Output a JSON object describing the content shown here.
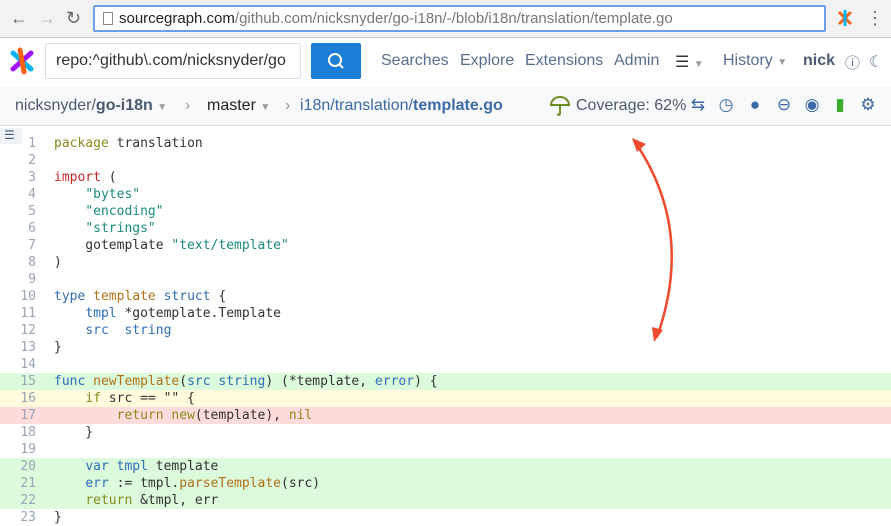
{
  "browser": {
    "url_host": "sourcegraph.com",
    "url_path": "/github.com/nicksnyder/go-i18n/-/blob/i18n/translation/template.go",
    "back_icon": "←",
    "forward_icon": "→",
    "reload_icon": "↻",
    "menu_icon": "⋮"
  },
  "nav": {
    "search_value": "repo:^github\\.com/nicksnyder/go",
    "links": [
      "Searches",
      "Explore",
      "Extensions",
      "Admin"
    ],
    "history": "History",
    "user": "nick"
  },
  "crumbs": {
    "repo_owner": "nicksnyder/",
    "repo_name": "go-i18n",
    "branch": "master",
    "path_dir1": "i18n",
    "sep": "/",
    "path_dir2": "translation",
    "file": "template.go",
    "coverage": "Coverage: 62%"
  },
  "colors": {
    "accent": "#1c7ed6",
    "covered": "#dcfadc",
    "partial": "#fffbdc",
    "uncovered": "#ffdcdc",
    "annotation_arrow": "#f04a2e"
  },
  "code": [
    {
      "n": "1",
      "c": "",
      "t": [
        [
          "package",
          "kw"
        ],
        [
          " translation",
          "id"
        ]
      ]
    },
    {
      "n": "2",
      "c": "",
      "t": []
    },
    {
      "n": "3",
      "c": "",
      "t": [
        [
          "import",
          "imp"
        ],
        [
          " (",
          "id"
        ]
      ]
    },
    {
      "n": "4",
      "c": "",
      "t": [
        [
          "    ",
          "id"
        ],
        [
          "\"bytes\"",
          "str"
        ]
      ]
    },
    {
      "n": "5",
      "c": "",
      "t": [
        [
          "    ",
          "id"
        ],
        [
          "\"encoding\"",
          "str"
        ]
      ]
    },
    {
      "n": "6",
      "c": "",
      "t": [
        [
          "    ",
          "id"
        ],
        [
          "\"strings\"",
          "str"
        ]
      ]
    },
    {
      "n": "7",
      "c": "",
      "t": [
        [
          "    gotemplate ",
          "id"
        ],
        [
          "\"text/template\"",
          "str"
        ]
      ]
    },
    {
      "n": "8",
      "c": "",
      "t": [
        [
          ")",
          "id"
        ]
      ]
    },
    {
      "n": "9",
      "c": "",
      "t": []
    },
    {
      "n": "10",
      "c": "",
      "t": [
        [
          "type",
          "typ"
        ],
        [
          " ",
          "id"
        ],
        [
          "template",
          "fn"
        ],
        [
          " ",
          "id"
        ],
        [
          "struct",
          "typ"
        ],
        [
          " {",
          "id"
        ]
      ]
    },
    {
      "n": "11",
      "c": "",
      "t": [
        [
          "    ",
          "id"
        ],
        [
          "tmpl",
          "typ"
        ],
        [
          " *gotemplate.Template",
          "id"
        ]
      ]
    },
    {
      "n": "12",
      "c": "",
      "t": [
        [
          "    ",
          "id"
        ],
        [
          "src",
          "typ"
        ],
        [
          "  ",
          "id"
        ],
        [
          "string",
          "typ"
        ]
      ]
    },
    {
      "n": "13",
      "c": "",
      "t": [
        [
          "}",
          "id"
        ]
      ]
    },
    {
      "n": "14",
      "c": "",
      "t": []
    },
    {
      "n": "15",
      "c": "g",
      "t": [
        [
          "func",
          "typ"
        ],
        [
          " ",
          "id"
        ],
        [
          "newTemplate",
          "fn"
        ],
        [
          "(",
          "id"
        ],
        [
          "src",
          "typ"
        ],
        [
          " ",
          "id"
        ],
        [
          "string",
          "typ"
        ],
        [
          ") (*template, ",
          "id"
        ],
        [
          "error",
          "typ"
        ],
        [
          ") {",
          "id"
        ]
      ]
    },
    {
      "n": "16",
      "c": "y",
      "t": [
        [
          "    ",
          "id"
        ],
        [
          "if",
          "kw"
        ],
        [
          " src == \"\" {",
          "id"
        ]
      ]
    },
    {
      "n": "17",
      "c": "r",
      "t": [
        [
          "        ",
          "id"
        ],
        [
          "return",
          "kw"
        ],
        [
          " ",
          "id"
        ],
        [
          "new",
          "kw"
        ],
        [
          "(template), ",
          "id"
        ],
        [
          "nil",
          "kw"
        ]
      ]
    },
    {
      "n": "18",
      "c": "",
      "t": [
        [
          "    }",
          "id"
        ]
      ]
    },
    {
      "n": "19",
      "c": "",
      "t": []
    },
    {
      "n": "20",
      "c": "g",
      "t": [
        [
          "    ",
          "id"
        ],
        [
          "var",
          "typ"
        ],
        [
          " ",
          "id"
        ],
        [
          "tmpl",
          "typ"
        ],
        [
          " template",
          "id"
        ]
      ]
    },
    {
      "n": "21",
      "c": "g",
      "t": [
        [
          "    ",
          "id"
        ],
        [
          "err",
          "typ"
        ],
        [
          " := tmpl.",
          "id"
        ],
        [
          "parseTemplate",
          "fn"
        ],
        [
          "(src)",
          "id"
        ]
      ]
    },
    {
      "n": "22",
      "c": "g",
      "t": [
        [
          "    ",
          "id"
        ],
        [
          "return",
          "kw"
        ],
        [
          " &tmpl, err",
          "id"
        ]
      ]
    },
    {
      "n": "23",
      "c": "",
      "t": [
        [
          "}",
          "id"
        ]
      ]
    }
  ]
}
